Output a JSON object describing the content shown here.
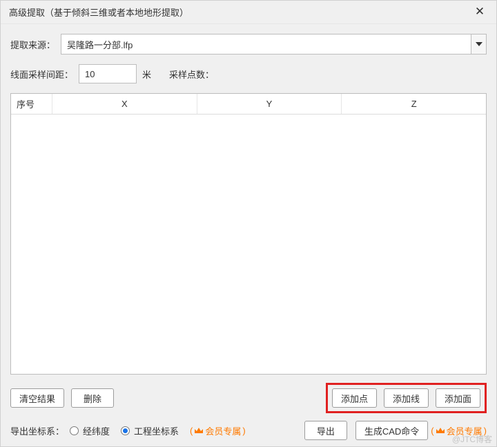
{
  "titlebar": {
    "title": "高级提取（基于倾斜三维或者本地地形提取）"
  },
  "source": {
    "label": "提取来源：",
    "value": "吴隆路一分部.lfp"
  },
  "sampling": {
    "interval_label": "线面采样间距：",
    "interval_value": "10",
    "unit": "米",
    "count_label": "采样点数：",
    "count_value": ""
  },
  "table": {
    "headers": {
      "seq": "序号",
      "x": "X",
      "y": "Y",
      "z": "Z"
    },
    "rows": []
  },
  "buttons": {
    "clear": "清空结果",
    "delete": "删除",
    "add_point": "添加点",
    "add_line": "添加线",
    "add_face": "添加面",
    "export": "导出",
    "gen_cad": "生成CAD命令"
  },
  "export_coord": {
    "label": "导出坐标系：",
    "lnglat": "经纬度",
    "engineering": "工程坐标系",
    "vip_label": "会员专属"
  },
  "watermark": "@JTC博客"
}
